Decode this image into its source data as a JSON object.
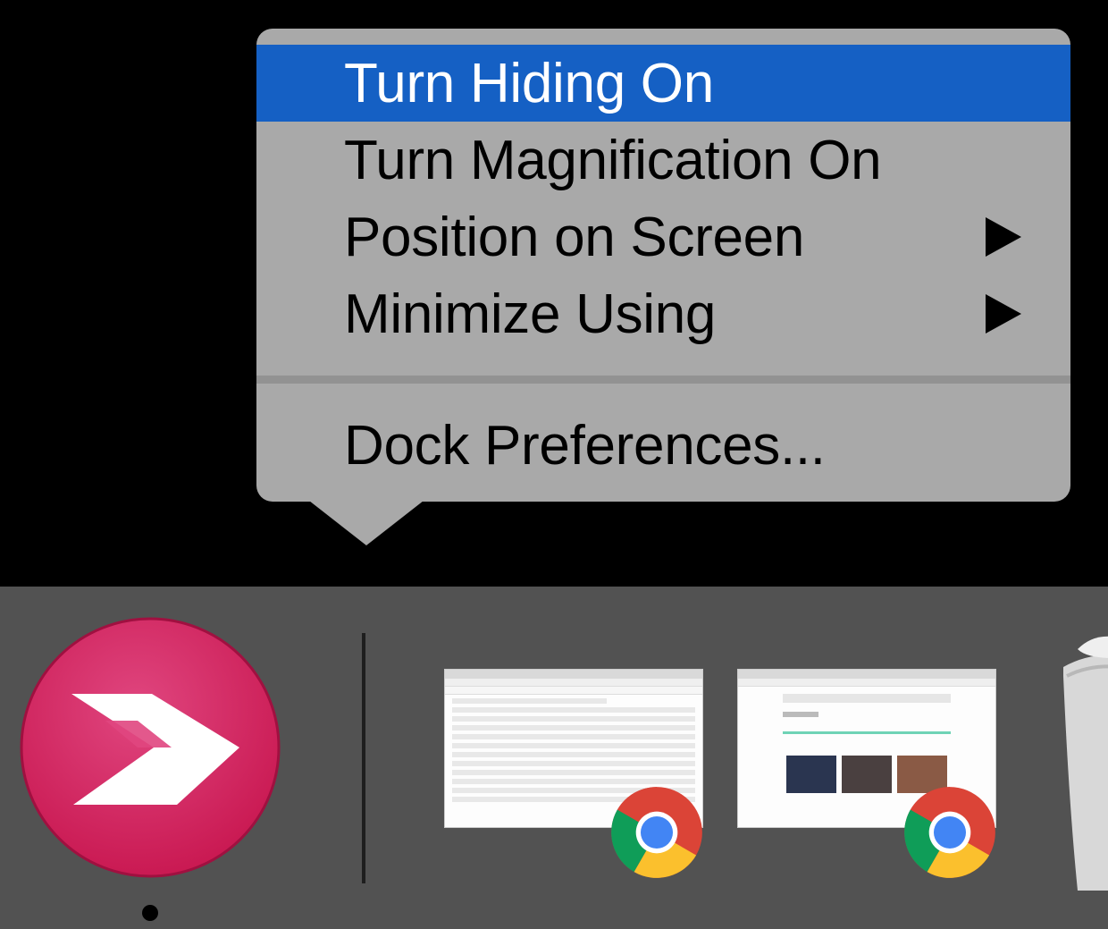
{
  "context_menu": {
    "items": [
      {
        "label": "Turn Hiding On",
        "selected": true,
        "submenu": false
      },
      {
        "label": "Turn Magnification On",
        "selected": false,
        "submenu": false
      },
      {
        "label": "Position on Screen",
        "selected": false,
        "submenu": true
      },
      {
        "label": "Minimize Using",
        "selected": false,
        "submenu": true
      }
    ],
    "preferences_label": "Dock Preferences...",
    "colors": {
      "background": "#a9a9a9",
      "selected": "#1560c4"
    }
  },
  "dock": {
    "background": "#525252",
    "apps": [
      {
        "icon": "skitch-icon",
        "running": true
      },
      {
        "icon": "chrome-window-thumbnail-spreadsheet",
        "badge": "chrome-icon"
      },
      {
        "icon": "chrome-window-thumbnail-library",
        "badge": "chrome-icon"
      },
      {
        "icon": "trash-icon"
      }
    ]
  }
}
